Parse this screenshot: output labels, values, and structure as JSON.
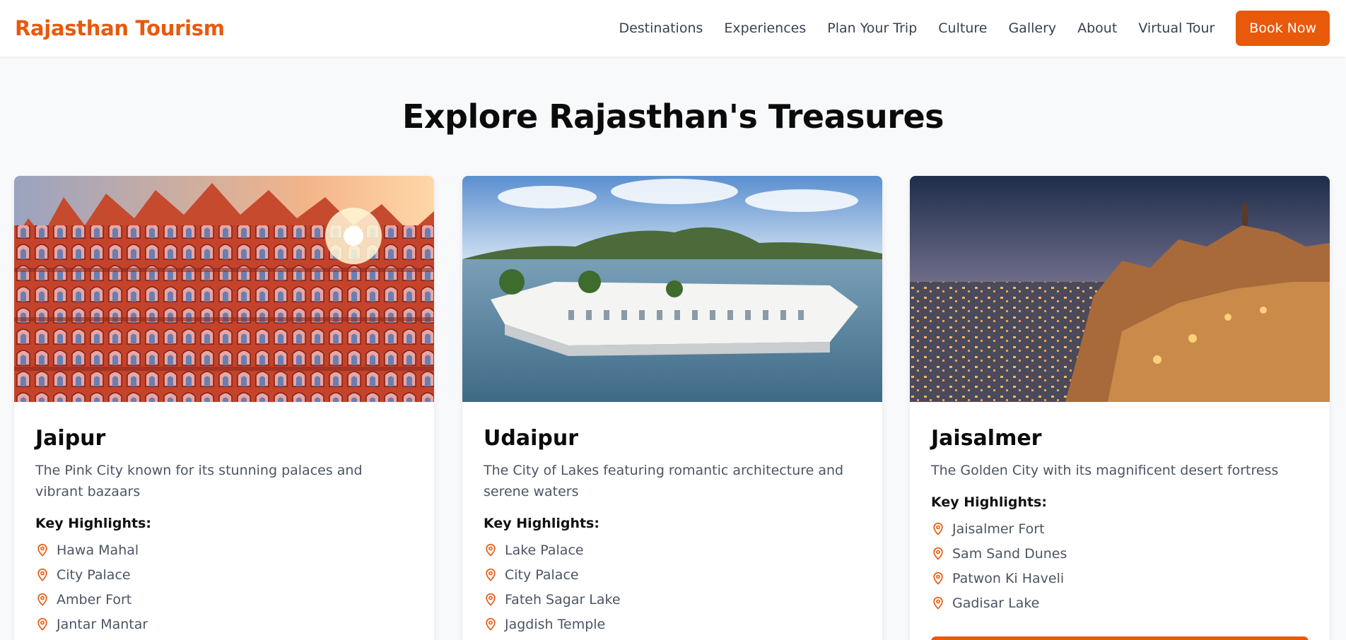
{
  "header": {
    "logo": "Rajasthan Tourism",
    "nav": [
      "Destinations",
      "Experiences",
      "Plan Your Trip",
      "Culture",
      "Gallery",
      "About",
      "Virtual Tour"
    ],
    "cta": "Book Now"
  },
  "section": {
    "title": "Explore Rajasthan's Treasures"
  },
  "cards": [
    {
      "title": "Jaipur",
      "description": "The Pink City known for its stunning palaces and vibrant bazaars",
      "highlights_label": "Key Highlights:",
      "highlights": [
        "Hawa Mahal",
        "City Palace",
        "Amber Fort",
        "Jantar Mantar"
      ]
    },
    {
      "title": "Udaipur",
      "description": "The City of Lakes featuring romantic architecture and serene waters",
      "highlights_label": "Key Highlights:",
      "highlights": [
        "Lake Palace",
        "City Palace",
        "Fateh Sagar Lake",
        "Jagdish Temple"
      ]
    },
    {
      "title": "Jaisalmer",
      "description": "The Golden City with its magnificent desert fortress",
      "highlights_label": "Key Highlights:",
      "highlights": [
        "Jaisalmer Fort",
        "Sam Sand Dunes",
        "Patwon Ki Haveli",
        "Gadisar Lake"
      ]
    }
  ],
  "colors": {
    "brand": "#e8590c",
    "pin_icon": "map-pin-icon"
  }
}
